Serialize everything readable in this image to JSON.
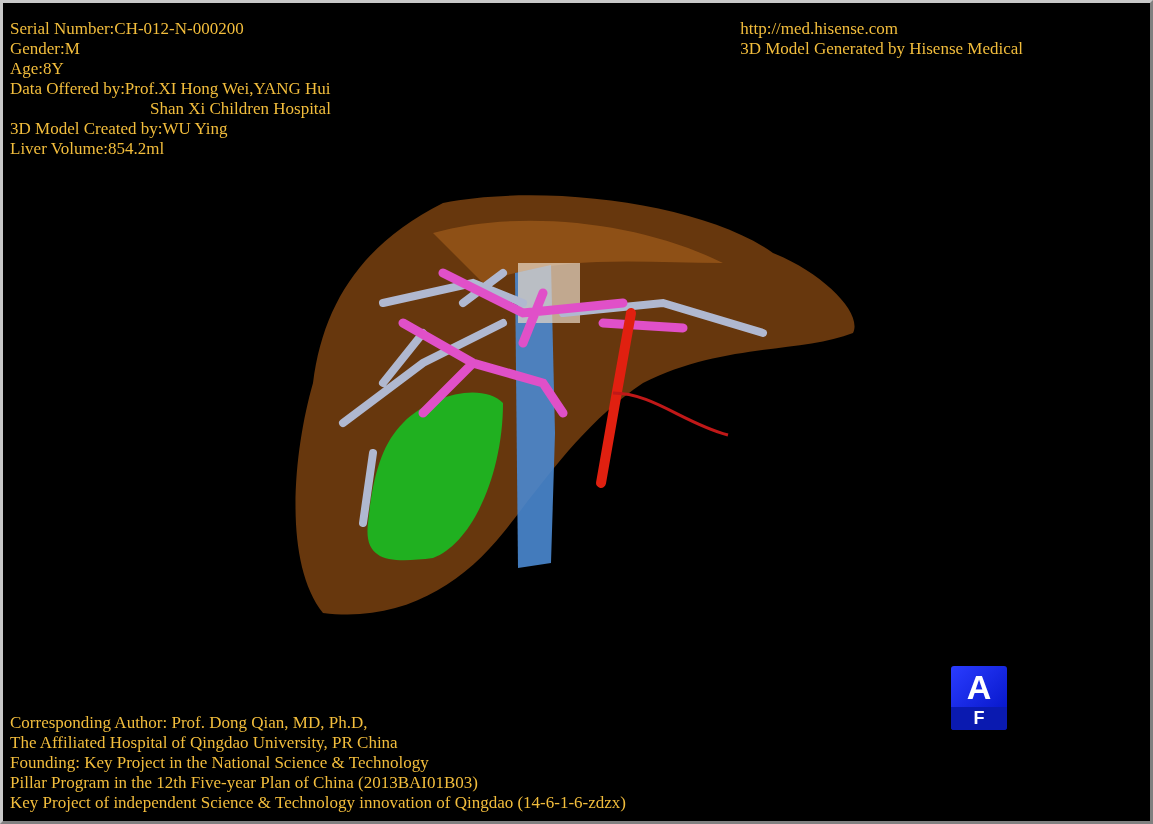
{
  "patient_info": [
    "Serial Number:CH-012-N-000200",
    "Gender:M",
    "Age:8Y",
    "Data Offered by:Prof.XI Hong Wei,YANG Hui"
  ],
  "hospital_line": "Shan Xi Children Hospital",
  "model_info": [
    "3D Model Created by:WU Ying",
    "Liver Volume:854.2ml"
  ],
  "branding": [
    "http://med.hisense.com",
    "3D Model Generated by Hisense Medical"
  ],
  "credits": [
    "Corresponding Author: Prof. Dong Qian, MD, Ph.D,",
    "The Affiliated Hospital of Qingdao University, PR China",
    "Founding: Key Project in the National Science & Technology",
    "Pillar Program in the 12th Five-year Plan of China (2013BAI01B03)",
    "Key Project of independent Science & Technology innovation of Qingdao (14-6-1-6-zdzx)"
  ],
  "orientation_cube": {
    "front": "A",
    "bottom": "F"
  }
}
